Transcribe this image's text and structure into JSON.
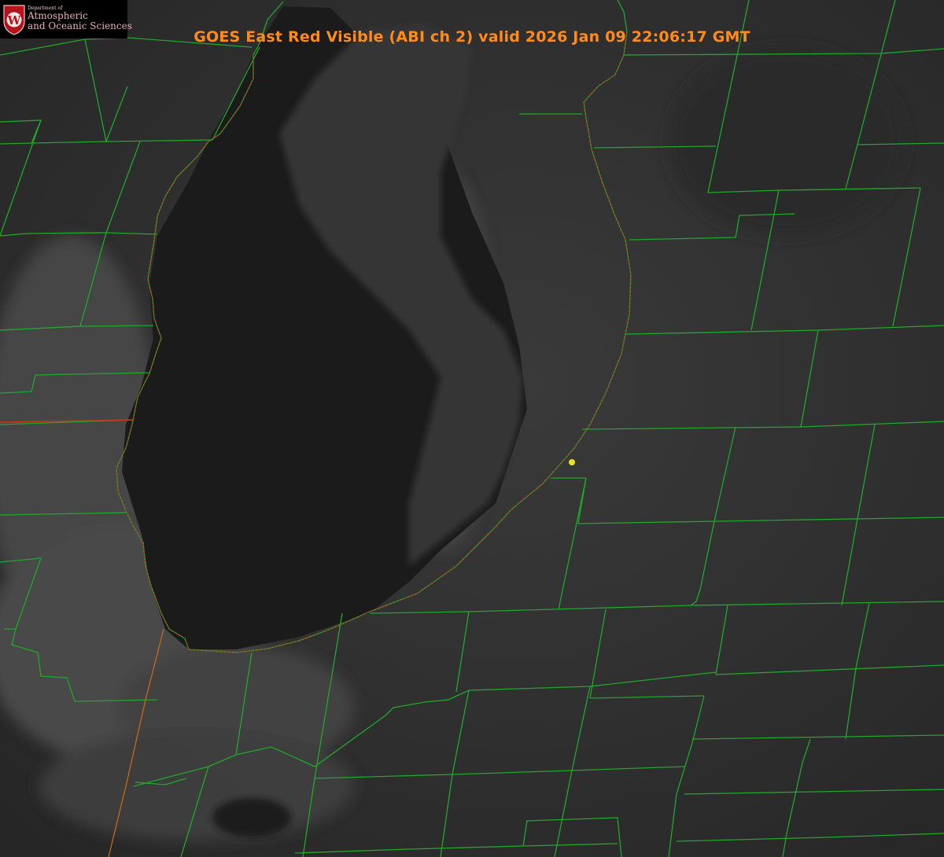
{
  "header": {
    "title": "GOES East Red Visible (ABI ch 2) valid 2026 Jan 09 22:06:17 GMT"
  },
  "logo": {
    "line_small": "Department of",
    "line_1": "Atmospheric",
    "line_2": "and Oceanic Sciences",
    "seal_letter": "W"
  },
  "colors": {
    "title": "#ff8c1a",
    "county_lines": "#1fa82a",
    "state_line": "#c23a1a",
    "shoreline": "#d81f1f",
    "marker": "#e8e02a",
    "background": "#000000"
  },
  "icons": {
    "seal": "uw-seal-icon",
    "marker": "location-dot-icon"
  }
}
